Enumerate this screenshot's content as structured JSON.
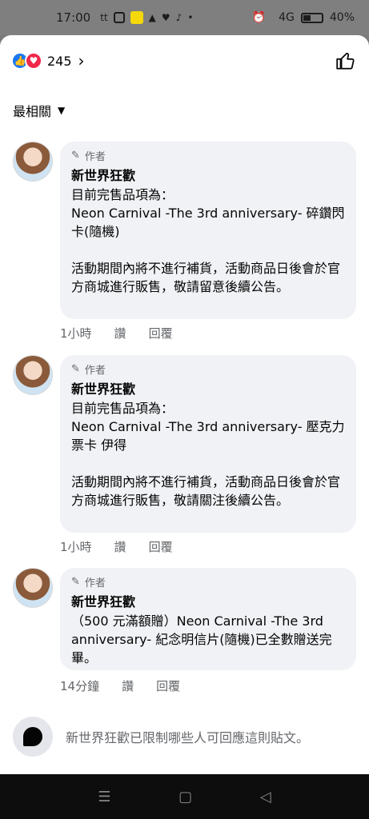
{
  "status": {
    "time": "17:00",
    "battery": "40%",
    "signal": "4G"
  },
  "reactions": {
    "count": "245",
    "icons": [
      "like-icon",
      "love-icon"
    ],
    "colors": {
      "like": "#1877f2",
      "love": "#f0284a"
    }
  },
  "sort": {
    "label": "最相關"
  },
  "comments": [
    {
      "badge": "作者",
      "author": "新世界狂歡",
      "text": "目前完售品項為：\nNeon Carnival -The 3rd anniversary- 碎鑽閃卡(隨機)\n\n活動期間內將不進行補貨，活動商品日後會於官方商城進行販售，敬請留意後續公告。",
      "time": "1小時",
      "like": "讚",
      "reply": "回覆"
    },
    {
      "badge": "作者",
      "author": "新世界狂歡",
      "text": "目前完售品項為：\nNeon Carnival -The 3rd anniversary- 壓克力票卡 伊得\n\n活動期間內將不進行補貨，活動商品日後會於官方商城進行販售，敬請關注後續公告。",
      "time": "1小時",
      "like": "讚",
      "reply": "回覆"
    },
    {
      "badge": "作者",
      "author": "新世界狂歡",
      "text": "（500 元滿額贈）Neon Carnival -The 3rd anniversary- 紀念明信片(隨機)已全數贈送完畢。",
      "time": "14分鐘",
      "like": "讚",
      "reply": "回覆"
    }
  ],
  "restricted": {
    "text": "新世界狂歡已限制哪些人可回應這則貼文。"
  }
}
